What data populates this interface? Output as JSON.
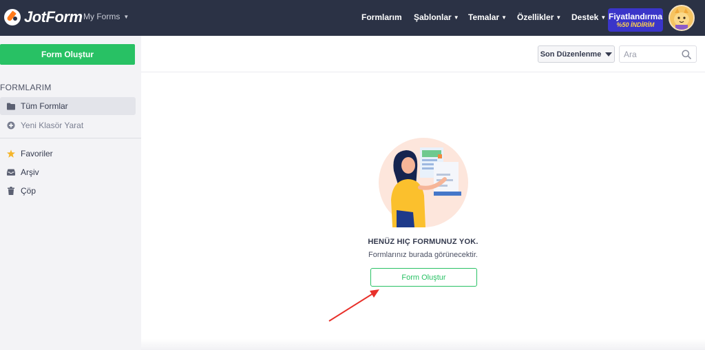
{
  "header": {
    "logo_text": "JotForm",
    "my_forms_label": "My Forms",
    "nav": [
      {
        "label": "Formlarım",
        "has_caret": false
      },
      {
        "label": "Şablonlar",
        "has_caret": true
      },
      {
        "label": "Temalar",
        "has_caret": true
      },
      {
        "label": "Özellikler",
        "has_caret": true
      },
      {
        "label": "Destek",
        "has_caret": true
      }
    ],
    "promo": {
      "line1": "Fiyatlandırma",
      "line2": "%50 İNDİRİM"
    }
  },
  "sidebar": {
    "create_label": "Form Oluştur",
    "section_title": "FORMLARIM",
    "items": [
      {
        "label": "Tüm Formlar",
        "icon": "folder-icon"
      },
      {
        "label": "Yeni Klasör Yarat",
        "icon": "plus-circle-icon"
      },
      {
        "label": "Favoriler",
        "icon": "star-icon"
      },
      {
        "label": "Arşiv",
        "icon": "inbox-icon"
      },
      {
        "label": "Çöp",
        "icon": "trash-icon"
      }
    ]
  },
  "toolbar": {
    "sort_label": "Son Düzenlenme",
    "search_placeholder": "Ara"
  },
  "empty_state": {
    "title": "HENÜZ HIÇ FORMUNUZ YOK.",
    "subtitle": "Formlarınız burada görünecektir.",
    "button_label": "Form Oluştur"
  },
  "colors": {
    "topbar": "#2b3245",
    "accent_green": "#28c164",
    "promo": "#3a35c9",
    "annotation_arrow": "#e8302a"
  }
}
